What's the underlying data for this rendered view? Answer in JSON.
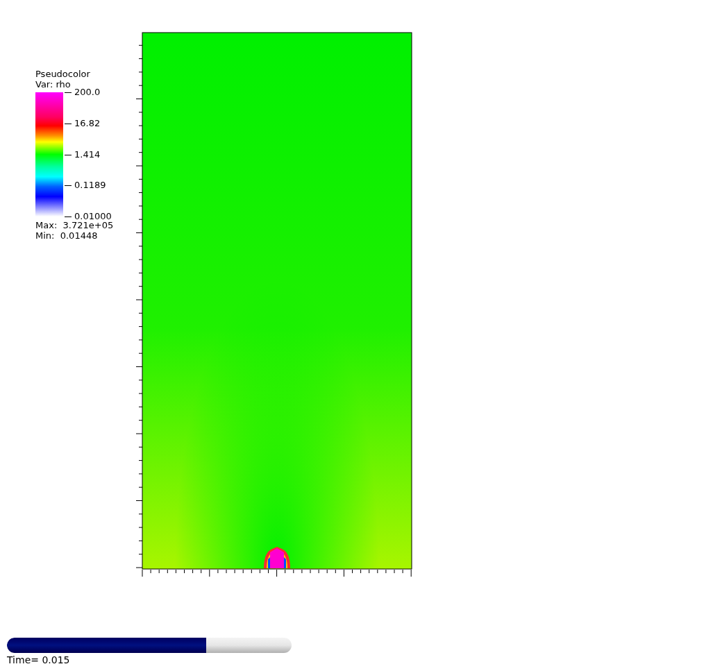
{
  "legend": {
    "title": "Pseudocolor",
    "variable": "Var: rho",
    "ticks": [
      "200.0",
      "16.82",
      "1.414",
      "0.1189",
      "0.01000"
    ],
    "max": "Max:  3.721e+05",
    "min": "Min:  0.01448"
  },
  "time_slider": {
    "level": 0.7,
    "label": "Time= 0.015"
  }
}
